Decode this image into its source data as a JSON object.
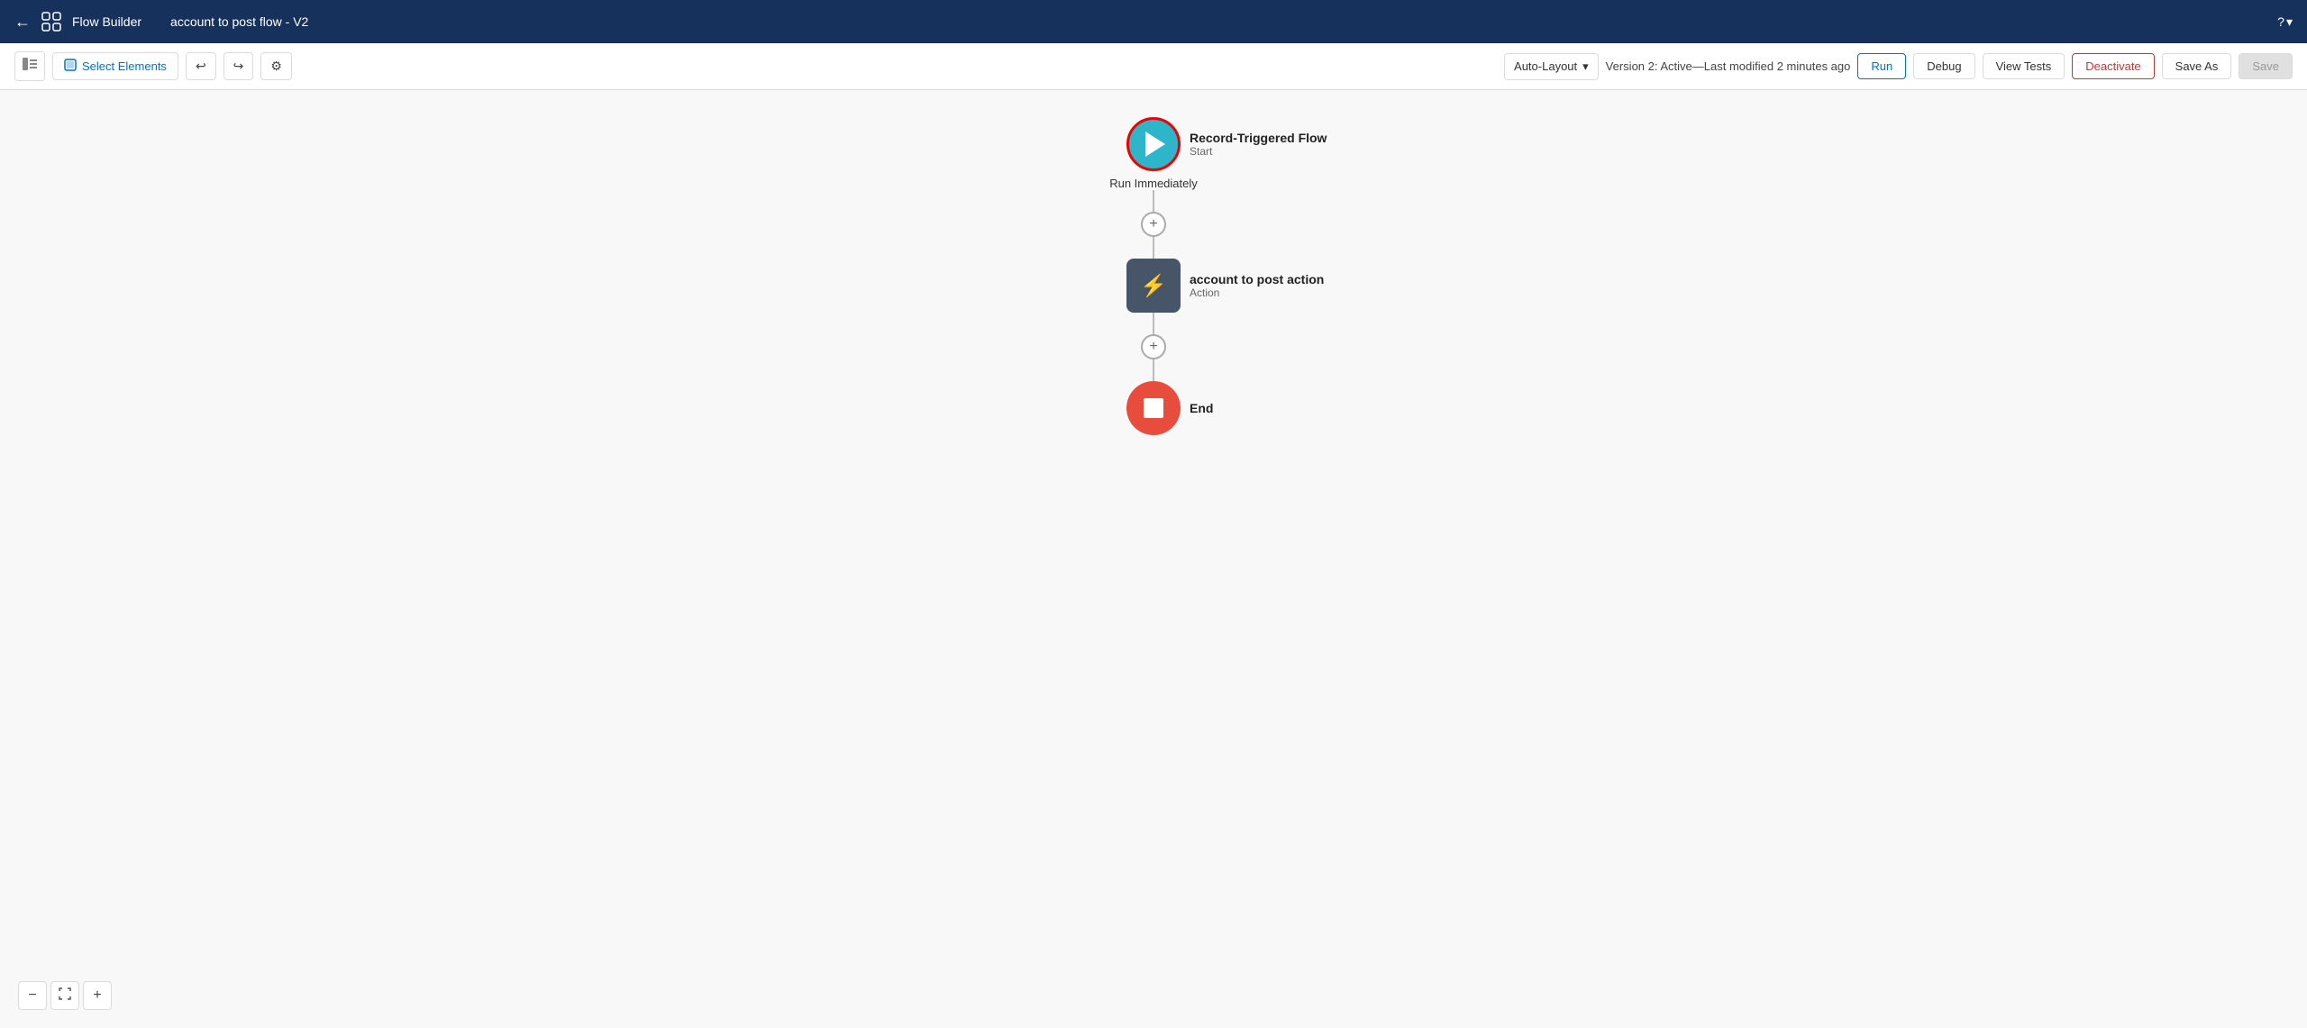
{
  "nav": {
    "back_label": "←",
    "logo_label": "≋",
    "app_title": "Flow Builder",
    "flow_name": "account to post flow - V2",
    "help_label": "?",
    "help_dropdown": "▾"
  },
  "toolbar": {
    "sidebar_toggle_label": "☰",
    "select_elements_label": "Select Elements",
    "undo_label": "↩",
    "redo_label": "↪",
    "settings_label": "⚙",
    "auto_layout_label": "Auto-Layout",
    "auto_layout_dropdown": "▾",
    "version_status": "Version 2: Active—Last modified 2 minutes ago",
    "run_label": "Run",
    "debug_label": "Debug",
    "view_tests_label": "View Tests",
    "deactivate_label": "Deactivate",
    "save_as_label": "Save As",
    "save_label": "Save"
  },
  "canvas": {
    "start_node": {
      "title": "Record-Triggered Flow",
      "subtitle": "Start",
      "below_label": "Run Immediately"
    },
    "action_node": {
      "title": "account to post action",
      "subtitle": "Action"
    },
    "end_node": {
      "label": "End"
    },
    "add_button_1": "+",
    "add_button_2": "+"
  },
  "zoom": {
    "zoom_out": "−",
    "fit": "⤢",
    "zoom_in": "+"
  },
  "colors": {
    "nav_bg": "#16325c",
    "start_node_bg": "#2eb5c9",
    "action_node_bg": "#475569",
    "end_node_bg": "#e74c3c",
    "selected_border": "#e00000",
    "run_btn_color": "#0070d2",
    "deactivate_color": "#c23934"
  }
}
